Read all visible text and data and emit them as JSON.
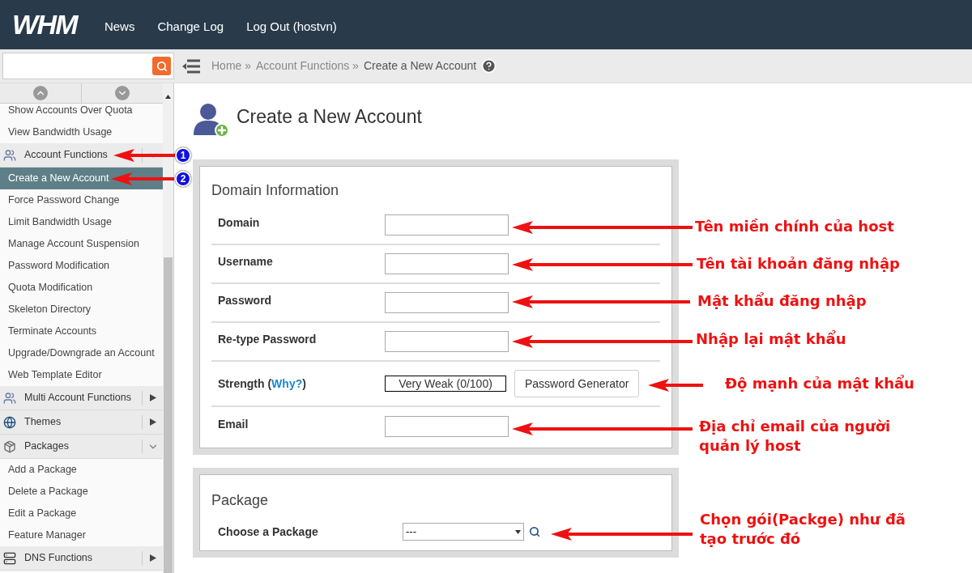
{
  "header": {
    "logo": "WHM",
    "nav": [
      "News",
      "Change Log",
      "Log Out (hostvn)"
    ]
  },
  "breadcrumb": {
    "items": [
      "Home »",
      "Account Functions »"
    ],
    "current": "Create a New Account"
  },
  "sidebar": {
    "items": [
      {
        "kind": "link",
        "label": "Show Accounts Over Quota",
        "selected": false
      },
      {
        "kind": "link",
        "label": "View Bandwidth Usage",
        "selected": false
      },
      {
        "kind": "section",
        "label": "Account Functions",
        "expanded": true
      },
      {
        "kind": "link",
        "label": "Create a New Account",
        "selected": true
      },
      {
        "kind": "link",
        "label": "Force Password Change",
        "selected": false
      },
      {
        "kind": "link",
        "label": "Limit Bandwidth Usage",
        "selected": false
      },
      {
        "kind": "link",
        "label": "Manage Account Suspension",
        "selected": false
      },
      {
        "kind": "link",
        "label": "Password Modification",
        "selected": false
      },
      {
        "kind": "link",
        "label": "Quota Modification",
        "selected": false
      },
      {
        "kind": "link",
        "label": "Skeleton Directory",
        "selected": false
      },
      {
        "kind": "link",
        "label": "Terminate Accounts",
        "selected": false
      },
      {
        "kind": "link",
        "label": "Upgrade/Downgrade an Account",
        "selected": false
      },
      {
        "kind": "link",
        "label": "Web Template Editor",
        "selected": false
      },
      {
        "kind": "section",
        "label": "Multi Account Functions",
        "expanded": false
      },
      {
        "kind": "section",
        "label": "Themes",
        "expanded": false
      },
      {
        "kind": "section",
        "label": "Packages",
        "expanded": true
      },
      {
        "kind": "link",
        "label": "Add a Package",
        "selected": false
      },
      {
        "kind": "link",
        "label": "Delete a Package",
        "selected": false
      },
      {
        "kind": "link",
        "label": "Edit a Package",
        "selected": false
      },
      {
        "kind": "link",
        "label": "Feature Manager",
        "selected": false
      },
      {
        "kind": "section",
        "label": "DNS Functions",
        "expanded": false
      }
    ]
  },
  "page_title": "Create a New Account",
  "domain_information": {
    "heading": "Domain Information",
    "fields": [
      {
        "kind": "text",
        "label": "Domain"
      },
      {
        "kind": "text",
        "label": "Username"
      },
      {
        "kind": "text",
        "label": "Password"
      },
      {
        "kind": "text",
        "label": "Re-type Password"
      },
      {
        "kind": "strength",
        "label": "Strength (",
        "link": "Why?",
        "label_end": ")",
        "meter": "Very Weak (0/100)",
        "button": "Password Generator"
      },
      {
        "kind": "text",
        "label": "Email"
      }
    ]
  },
  "package": {
    "heading": "Package",
    "label": "Choose a Package",
    "select_value": "---"
  },
  "annotations": [
    {
      "kind": "badge",
      "text": "1"
    },
    {
      "kind": "badge",
      "text": "2"
    },
    {
      "kind": "note",
      "text": "Tên miền chính của host"
    },
    {
      "kind": "note",
      "text": "Tên tài khoản đăng nhập"
    },
    {
      "kind": "note",
      "text": "Mật khẩu đăng nhập"
    },
    {
      "kind": "note",
      "text": "Nhập lại mật khẩu"
    },
    {
      "kind": "note",
      "text": "Độ mạnh của mật khẩu"
    },
    {
      "kind": "note",
      "text": "Địa chỉ email của người quản lý host"
    },
    {
      "kind": "note",
      "text": "Chọn gói(Packge) như đã tạo trước đó"
    }
  ]
}
